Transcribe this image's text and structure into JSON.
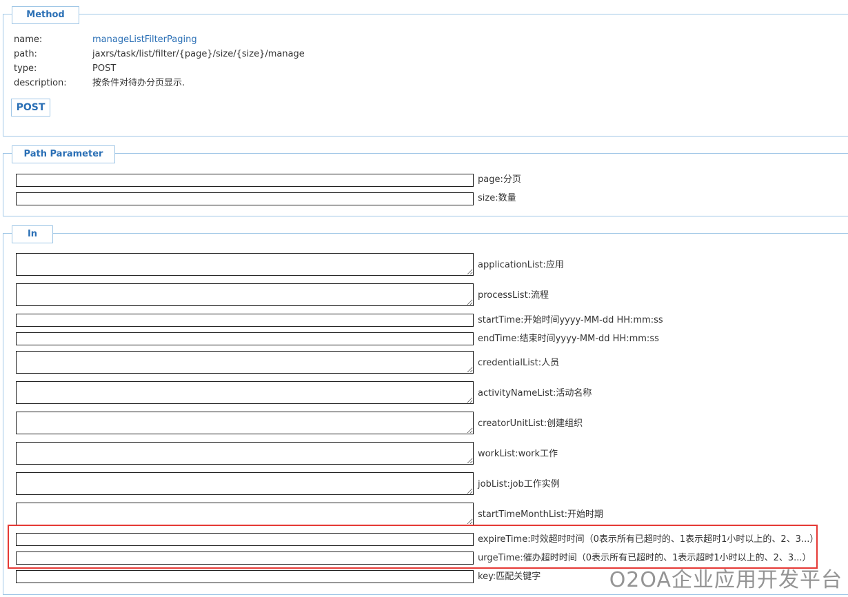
{
  "method": {
    "legend": "Method",
    "rows": [
      {
        "key": "name:",
        "value": "manageListFilterPaging"
      },
      {
        "key": "path:",
        "value": "jaxrs/task/list/filter/{page}/size/{size}/manage"
      },
      {
        "key": "type:",
        "value": "POST"
      },
      {
        "key": "description:",
        "value": "按条件对待办分页显示."
      }
    ],
    "button_label": "POST"
  },
  "path_parameter": {
    "legend": "Path Parameter",
    "params": [
      {
        "label": "page:分页"
      },
      {
        "label": "size:数量"
      }
    ]
  },
  "in": {
    "legend": "In",
    "params": [
      {
        "label": "applicationList:应用"
      },
      {
        "label": "processList:流程"
      },
      {
        "label": "startTime:开始时间yyyy-MM-dd HH:mm:ss"
      },
      {
        "label": "endTime:结束时间yyyy-MM-dd HH:mm:ss"
      },
      {
        "label": "credentialList:人员"
      },
      {
        "label": "activityNameList:活动名称"
      },
      {
        "label": "creatorUnitList:创建组织"
      },
      {
        "label": "workList:work工作"
      },
      {
        "label": "jobList:job工作实例"
      },
      {
        "label": "startTimeMonthList:开始时期"
      },
      {
        "label": "expireTime:时效超时时间（0表示所有已超时的、1表示超时1小时以上的、2、3...）"
      },
      {
        "label": "urgeTime:催办超时时间（0表示所有已超时的、1表示超时1小时以上的、2、3...）"
      },
      {
        "label": "key:匹配关键字"
      }
    ]
  },
  "watermark": "O2OA企业应用开发平台",
  "colors": {
    "accent": "#2a6fb5",
    "panel_border": "#9fc6e6",
    "highlight": "#e53935"
  }
}
